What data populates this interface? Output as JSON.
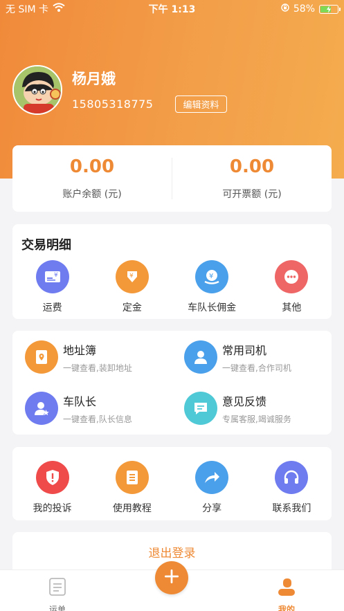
{
  "status_bar": {
    "carrier": "无 SIM 卡",
    "time": "下午 1:13",
    "battery": "58%",
    "battery_level": 0.58
  },
  "profile": {
    "name": "杨月娥",
    "phone": "15805318775",
    "edit_label": "编辑资料"
  },
  "balance": {
    "account_value": "0.00",
    "account_label": "账户余额 (元)",
    "invoice_value": "0.00",
    "invoice_label": "可开票额 (元)"
  },
  "transactions": {
    "title": "交易明细",
    "items": [
      {
        "label": "运费",
        "icon": "freight-icon",
        "color": "#6f7cf0"
      },
      {
        "label": "定金",
        "icon": "deposit-icon",
        "color": "#f3993a"
      },
      {
        "label": "车队长佣金",
        "icon": "commission-icon",
        "color": "#4aa0ea"
      },
      {
        "label": "其他",
        "icon": "more-icon",
        "color": "#ef6666"
      }
    ]
  },
  "services": [
    {
      "title": "地址簿",
      "subtitle": "一键查看,装卸地址",
      "icon": "address-book-icon",
      "color": "#f3993a"
    },
    {
      "title": "常用司机",
      "subtitle": "一键查看,合作司机",
      "icon": "driver-icon",
      "color": "#4aa0ea"
    },
    {
      "title": "车队长",
      "subtitle": "一键查看,队长信息",
      "icon": "captain-icon",
      "color": "#6f7cf0"
    },
    {
      "title": "意见反馈",
      "subtitle": "专属客服,竭诚服务",
      "icon": "feedback-icon",
      "color": "#4fc9d6"
    }
  ],
  "more": {
    "items": [
      {
        "label": "我的投诉",
        "icon": "complaint-icon",
        "color": "#ef4b4b"
      },
      {
        "label": "使用教程",
        "icon": "tutorial-icon",
        "color": "#f3993a"
      },
      {
        "label": "分享",
        "icon": "share-icon",
        "color": "#4aa0ea"
      },
      {
        "label": "联系我们",
        "icon": "headset-icon",
        "color": "#6f7cf0"
      }
    ]
  },
  "logout_label": "退出登录",
  "tabbar": {
    "orders_label": "运单",
    "mine_label": "我的",
    "active_color": "#ee8a35"
  }
}
